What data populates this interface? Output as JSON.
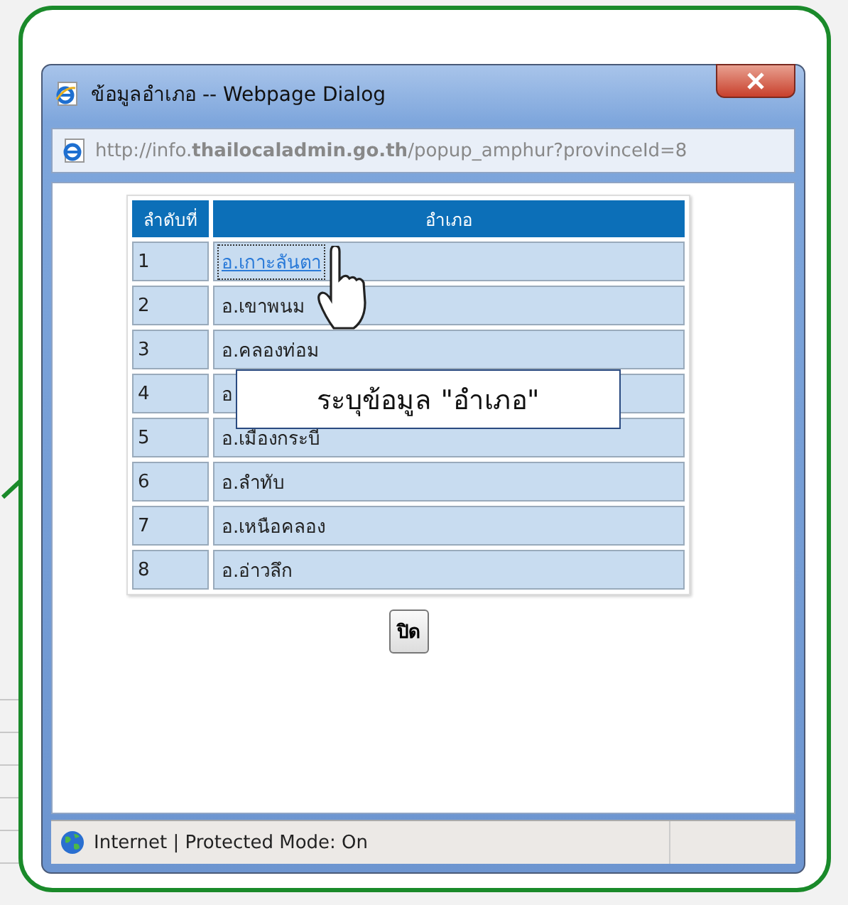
{
  "dialog": {
    "title": "ข้อมูลอำเภอ -- Webpage Dialog",
    "address": "http://info.**thailocaladmin.go.th**/popup_amphur?provinceId=8"
  },
  "table": {
    "columns": [
      "ลำดับที่",
      "อำเภอ"
    ],
    "rows": [
      {
        "number": "1",
        "district": "อ.เกาะลันตา",
        "focused": true
      },
      {
        "number": "2",
        "district": "อ.เขาพนม",
        "focused": false
      },
      {
        "number": "3",
        "district": "อ.คลองท่อม",
        "focused": false
      },
      {
        "number": "4",
        "district": "อ",
        "focused": false
      },
      {
        "number": "5",
        "district": "อ.เมืองกระบี่",
        "focused": false
      },
      {
        "number": "6",
        "district": "อ.ลำทับ",
        "focused": false
      },
      {
        "number": "7",
        "district": "อ.เหนือคลอง",
        "focused": false
      },
      {
        "number": "8",
        "district": "อ.อ่าวลึก",
        "focused": false
      }
    ]
  },
  "callout": "ระบุข้อมูล \"อำเภอ\"",
  "close_button": "ปิด",
  "status_bar": "Internet | Protected Mode: On"
}
